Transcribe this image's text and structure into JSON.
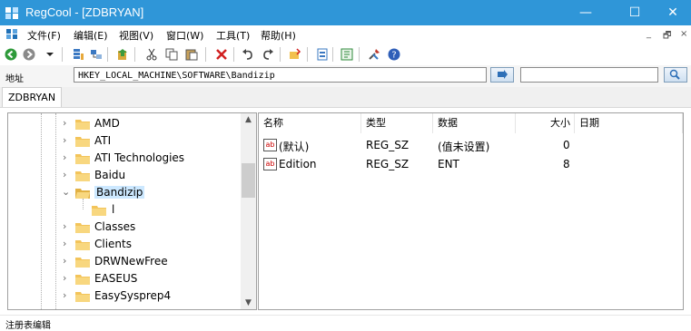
{
  "window": {
    "title": "RegCool - [ZDBRYAN]",
    "minimize_glyph": "—",
    "maximize_glyph": "☐",
    "close_glyph": "✕",
    "mdi_minimize_glyph": "_",
    "mdi_restore_glyph": "🗗",
    "mdi_close_glyph": "×",
    "title_bar_color": "#2f96d8"
  },
  "menu": {
    "items": [
      "文件(F)",
      "编辑(E)",
      "视图(V)",
      "窗口(W)",
      "工具(T)",
      "帮助(H)"
    ]
  },
  "toolbar": {
    "icons": [
      "back-icon",
      "forward-icon",
      "dropdown-arrow-icon",
      "registry-icon",
      "registry-network-icon",
      "export-icon",
      "cut-icon",
      "copy-icon",
      "paste-icon",
      "delete-icon",
      "undo-icon",
      "redo-icon",
      "bookmark-icon",
      "snapshot-icon",
      "compare-icon",
      "tools-icon",
      "help-icon"
    ]
  },
  "address": {
    "label": "地址",
    "path": "HKEY_LOCAL_MACHINE\\SOFTWARE\\Bandizip",
    "search_value": ""
  },
  "tabs": [
    {
      "label": "ZDBRYAN",
      "active": true
    }
  ],
  "tree": {
    "items": [
      {
        "label": "AMD",
        "expanded": false,
        "indent": 0
      },
      {
        "label": "ATI",
        "expanded": false,
        "indent": 0
      },
      {
        "label": "ATI Technologies",
        "expanded": false,
        "indent": 0
      },
      {
        "label": "Baidu",
        "expanded": false,
        "indent": 0
      },
      {
        "label": "Bandizip",
        "expanded": true,
        "indent": 0,
        "selected": true
      },
      {
        "label": "l",
        "expanded": false,
        "indent": 1
      },
      {
        "label": "Classes",
        "expanded": false,
        "indent": 0
      },
      {
        "label": "Clients",
        "expanded": false,
        "indent": 0
      },
      {
        "label": "DRWNewFree",
        "expanded": false,
        "indent": 0
      },
      {
        "label": "EASEUS",
        "expanded": false,
        "indent": 0
      },
      {
        "label": "EasySysprep4",
        "expanded": false,
        "indent": 0
      }
    ]
  },
  "list": {
    "columns": [
      "名称",
      "类型",
      "数据",
      "大小",
      "日期"
    ],
    "rows": [
      {
        "name": "(默认)",
        "type": "REG_SZ",
        "data": "(值未设置)",
        "size": "0",
        "date": ""
      },
      {
        "name": "Edition",
        "type": "REG_SZ",
        "data": "ENT",
        "size": "8",
        "date": ""
      }
    ]
  },
  "status": {
    "text": "注册表编辑"
  }
}
